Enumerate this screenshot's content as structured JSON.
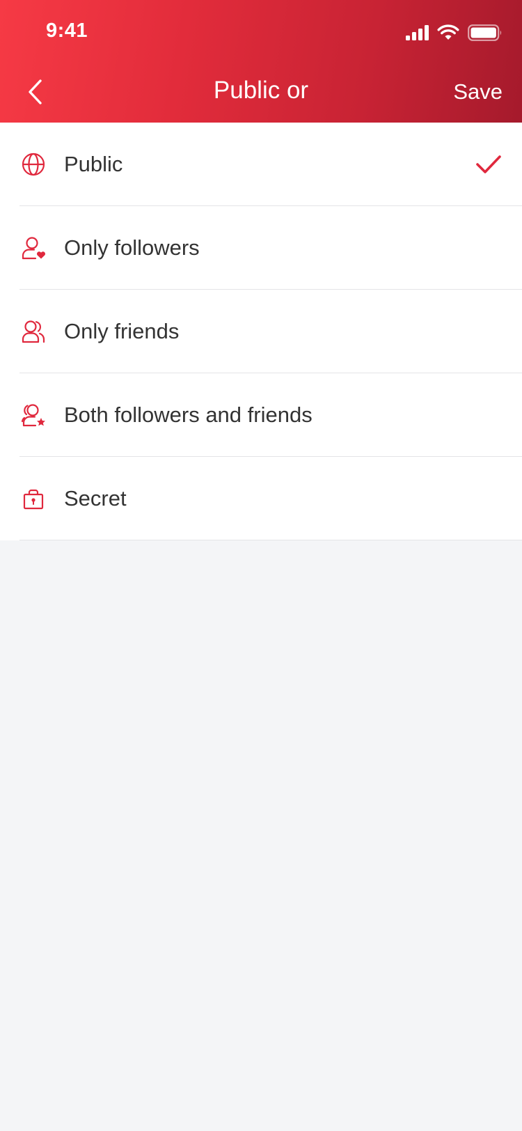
{
  "status_bar": {
    "time": "9:41",
    "icons": [
      "signal-icon",
      "wifi-icon",
      "battery-icon"
    ]
  },
  "nav": {
    "back_icon": "chevron-left-icon",
    "title": "Public or",
    "save_label": "Save"
  },
  "options": [
    {
      "label": "Public",
      "icon": "globe-icon",
      "selected": true
    },
    {
      "label": "Only followers",
      "icon": "user-heart-icon",
      "selected": false
    },
    {
      "label": "Only friends",
      "icon": "users-icon",
      "selected": false
    },
    {
      "label": "Both followers and friends",
      "icon": "user-star-icon",
      "selected": false
    },
    {
      "label": "Secret",
      "icon": "lock-icon",
      "selected": false
    }
  ],
  "colors": {
    "accent": "#e0283d",
    "header_gradient_start": "#f63a45",
    "header_gradient_end": "#a51a2c",
    "background": "#f4f5f7",
    "text": "#333333"
  }
}
